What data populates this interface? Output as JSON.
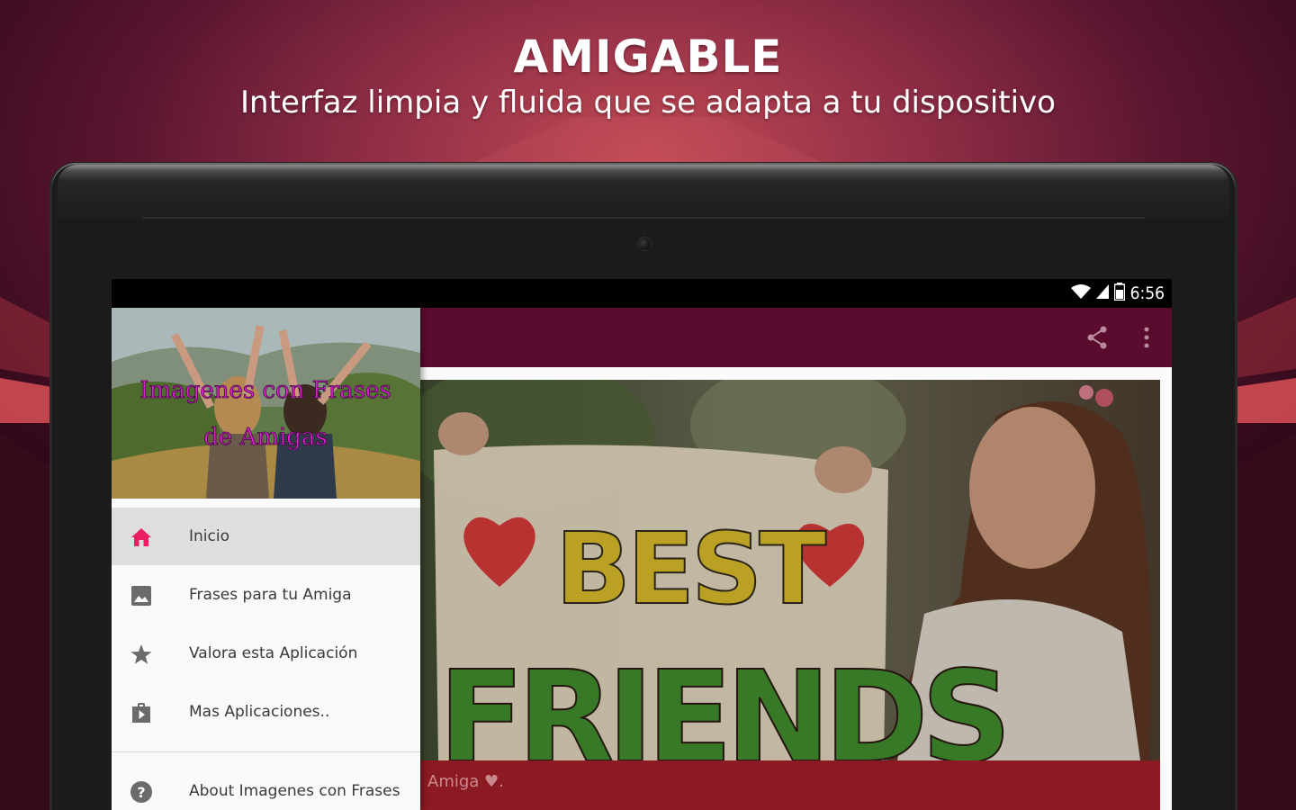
{
  "promo": {
    "headline": "AMIGABLE",
    "subline": "Interfaz limpia y fluida que se adapta a tu dispositivo"
  },
  "status_bar": {
    "time": "6:56",
    "icons": [
      "wifi-icon",
      "signal-icon",
      "battery-icon"
    ]
  },
  "app_bar": {
    "actions": [
      "share-icon",
      "overflow-menu-icon"
    ],
    "colors": {
      "primary": "#5a0c2e"
    }
  },
  "drawer": {
    "header_title_line1": "Imagenes con Frases",
    "header_title_line2": "de Amigas",
    "items": [
      {
        "label": "Inicio",
        "icon": "home-icon",
        "active": true
      },
      {
        "label": "Frases para tu Amiga",
        "icon": "image-icon",
        "active": false
      },
      {
        "label": "Valora esta Aplicación",
        "icon": "star-icon",
        "active": false
      },
      {
        "label": "Mas Aplicaciones..",
        "icon": "shop-icon",
        "active": false
      },
      {
        "label": "About Imagenes con Frases",
        "icon": "help-icon",
        "active": false
      }
    ],
    "colors": {
      "active_icon": "#e91e63",
      "icon": "#6b6b6b"
    }
  },
  "card": {
    "sign_line1": "BEST",
    "sign_line2": "FRIENDS",
    "caption": "Amiga ♥."
  }
}
